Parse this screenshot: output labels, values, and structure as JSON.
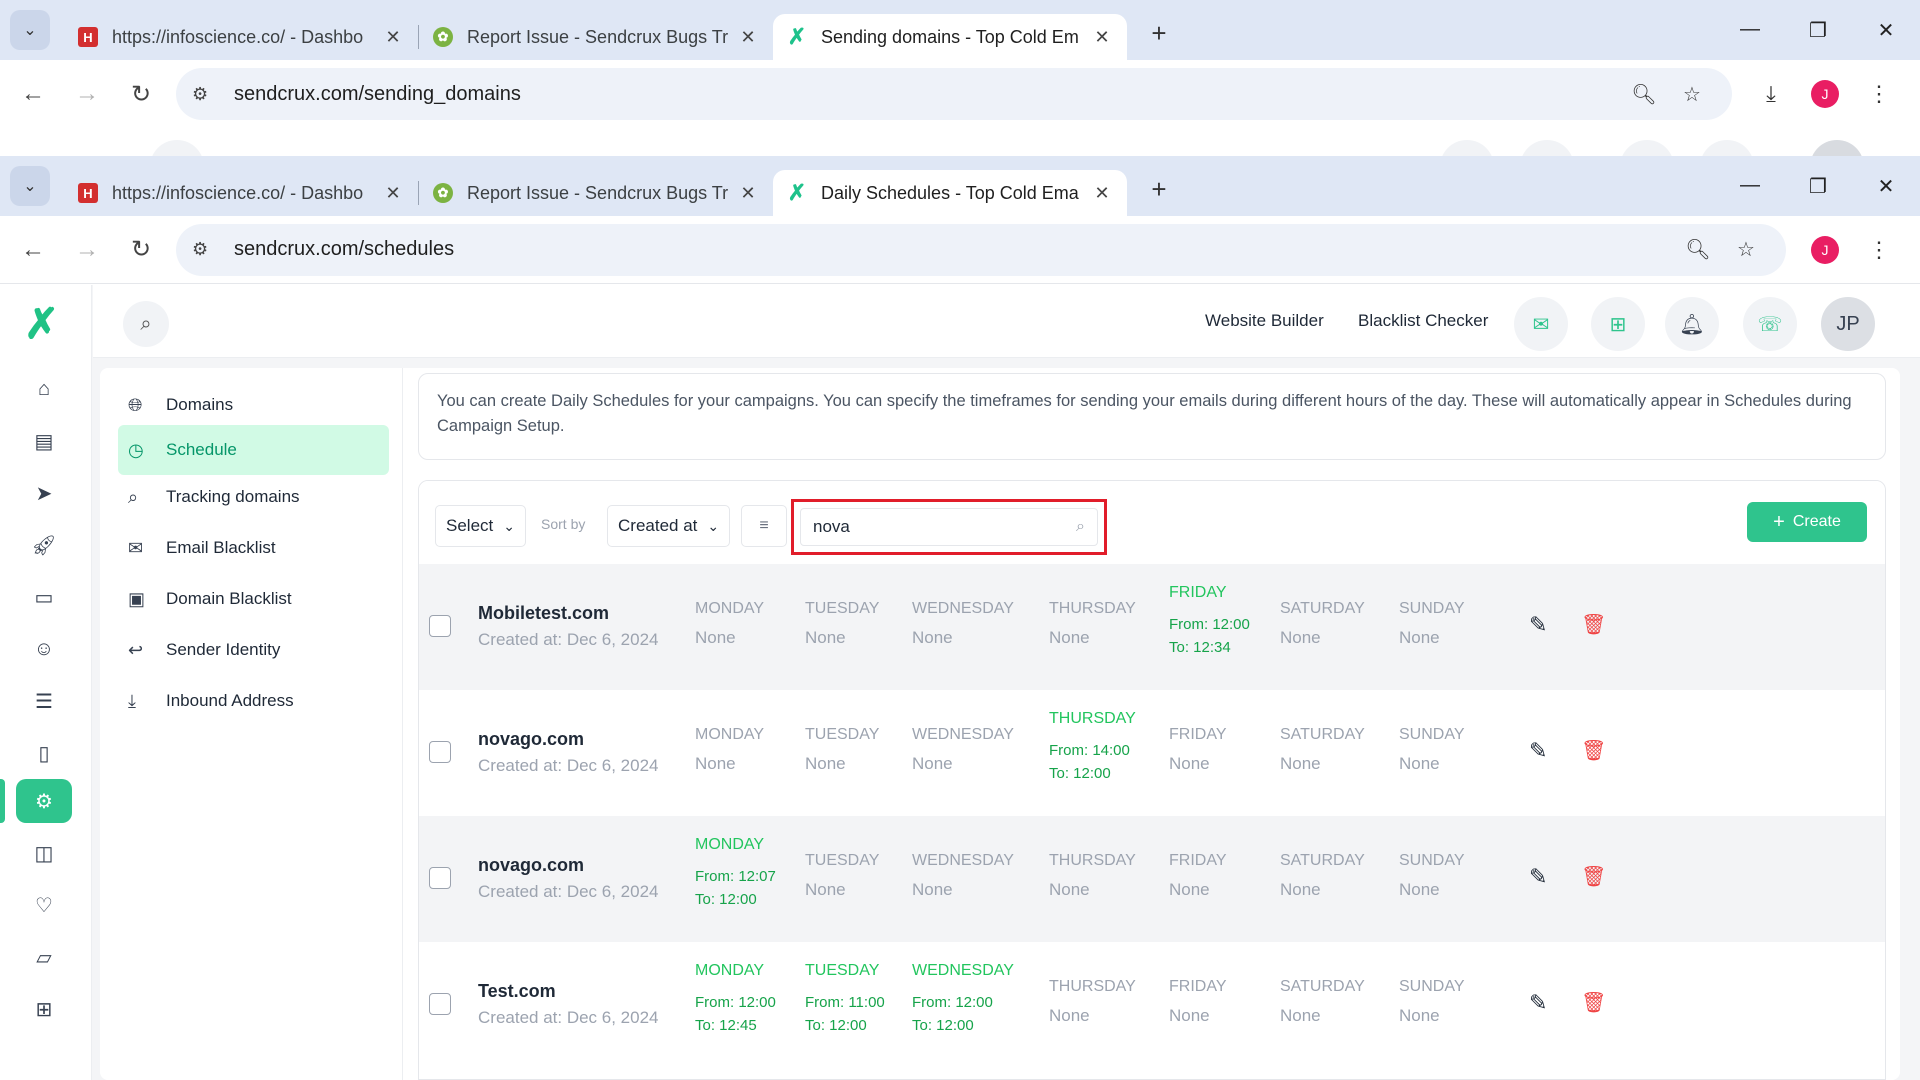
{
  "browser_back": {
    "tabs": [
      {
        "favicon": "H",
        "title": "https://infoscience.co/ - Dashbo"
      },
      {
        "favicon": "bug",
        "title": "Report Issue - Sendcrux Bugs Tr"
      },
      {
        "favicon": "x",
        "title": "Sending domains - Top Cold Em"
      }
    ],
    "url": "sendcrux.com/sending_domains",
    "profile": "J"
  },
  "browser": {
    "tabs": [
      {
        "favicon": "H",
        "title": "https://infoscience.co/ - Dashbo"
      },
      {
        "favicon": "bug",
        "title": "Report Issue - Sendcrux Bugs Tr"
      },
      {
        "favicon": "x",
        "title": "Daily Schedules - Top Cold Ema"
      }
    ],
    "url": "sendcrux.com/schedules",
    "profile": "J"
  },
  "topbar": {
    "website_builder": "Website Builder",
    "blacklist_checker": "Blacklist Checker",
    "avatar": "JP"
  },
  "settings_nav": [
    {
      "label": "Domains",
      "icon": "globe-icon"
    },
    {
      "label": "Schedule",
      "icon": "clock-icon",
      "active": true
    },
    {
      "label": "Tracking domains",
      "icon": "tracking-icon"
    },
    {
      "label": "Email Blacklist",
      "icon": "mail-icon"
    },
    {
      "label": "Domain Blacklist",
      "icon": "domain-blacklist-icon"
    },
    {
      "label": "Sender Identity",
      "icon": "reply-icon"
    },
    {
      "label": "Inbound Address",
      "icon": "download-icon"
    }
  ],
  "info_text": "You can create Daily Schedules for your campaigns. You can specify the timeframes for sending your emails during different hours of the day. These will automatically appear in Schedules during Campaign Setup.",
  "toolbar": {
    "select_label": "Select",
    "sort_by_label": "Sort by",
    "sort_value": "Created at",
    "search_value": "nova",
    "create_label": "Create"
  },
  "days": [
    "MONDAY",
    "TUESDAY",
    "WEDNESDAY",
    "THURSDAY",
    "FRIDAY",
    "SATURDAY",
    "SUNDAY"
  ],
  "none_label": "None",
  "schedules": [
    {
      "name": "Mobiletest.com",
      "created": "Created at: Dec 6, 2024",
      "slots": [
        null,
        null,
        null,
        null,
        {
          "from": "From: 12:00",
          "to": "To: 12:34"
        },
        null,
        null
      ]
    },
    {
      "name": "novago.com",
      "created": "Created at: Dec 6, 2024",
      "slots": [
        null,
        null,
        null,
        {
          "from": "From: 14:00",
          "to": "To: 12:00"
        },
        null,
        null,
        null
      ]
    },
    {
      "name": "novago.com",
      "created": "Created at: Dec 6, 2024",
      "slots": [
        {
          "from": "From: 12:07",
          "to": "To: 12:00"
        },
        null,
        null,
        null,
        null,
        null,
        null
      ]
    },
    {
      "name": "Test.com",
      "created": "Created at: Dec 6, 2024",
      "slots": [
        {
          "from": "From: 12:00",
          "to": "To: 12:45"
        },
        {
          "from": "From: 11:00",
          "to": "To: 12:00"
        },
        {
          "from": "From: 12:00",
          "to": "To: 12:00"
        },
        null,
        null,
        null,
        null
      ]
    }
  ],
  "colors": {
    "accent": "#2fc48d",
    "active_day": "#22c55e",
    "delete": "#ef4444",
    "highlight_border": "#e11d2a"
  }
}
